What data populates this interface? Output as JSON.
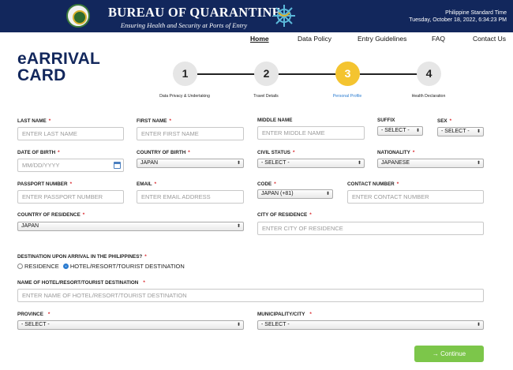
{
  "header": {
    "title": "BUREAU OF QUARANTINE",
    "subtitle": "Ensuring Health and Security at Ports of Entry",
    "time_zone": "Philippine Standard Time",
    "datetime": "Tuesday, October 18, 2022, 6:34:23 PM",
    "bg_color": "#12275c"
  },
  "nav": {
    "items": [
      "Home",
      "Data Policy",
      "Entry Guidelines",
      "FAQ",
      "Contact Us"
    ],
    "active": "Home"
  },
  "page_title": {
    "line1": "eARRIVAL",
    "line2": "CARD"
  },
  "stepper": {
    "steps": [
      {
        "number": "1",
        "label": "Data Privacy & Undertaking"
      },
      {
        "number": "2",
        "label": "Travel Details"
      },
      {
        "number": "3",
        "label": "Personal Profile"
      },
      {
        "number": "4",
        "label": "Health Declaration"
      }
    ],
    "active_step": 3,
    "active_color": "#f4c430"
  },
  "form": {
    "last_name": {
      "label": "LAST NAME",
      "placeholder": "ENTER LAST NAME"
    },
    "first_name": {
      "label": "FIRST NAME",
      "placeholder": "ENTER FIRST NAME"
    },
    "middle_name": {
      "label": "MIDDLE NAME",
      "placeholder": "ENTER MIDDLE NAME"
    },
    "suffix": {
      "label": "SUFFIX",
      "value": "- SELECT -"
    },
    "sex": {
      "label": "SEX",
      "value": "- SELECT -"
    },
    "dob": {
      "label": "DATE OF BIRTH",
      "placeholder": "MM/DD/YYYY"
    },
    "country_of_birth": {
      "label": "COUNTRY OF BIRTH",
      "value": "JAPAN"
    },
    "civil_status": {
      "label": "CIVIL STATUS",
      "value": "- SELECT -"
    },
    "nationality": {
      "label": "NATIONALITY",
      "value": "JAPANESE"
    },
    "passport": {
      "label": "PASSPORT NUMBER",
      "placeholder": "ENTER PASSPORT NUMBER"
    },
    "email": {
      "label": "EMAIL",
      "placeholder": "ENTER EMAIL ADDRESS"
    },
    "code": {
      "label": "CODE",
      "value": "JAPAN (+81)"
    },
    "contact": {
      "label": "CONTACT NUMBER",
      "placeholder": "ENTER CONTACT NUMBER"
    },
    "country_residence": {
      "label": "COUNTRY OF RESIDENCE",
      "value": "JAPAN"
    },
    "city_residence": {
      "label": "CITY OF RESIDENCE",
      "placeholder": "ENTER CITY OF RESIDENCE"
    },
    "destination": {
      "label": "DESTINATION UPON ARRIVAL IN THE PHILIPPINES?",
      "option1": "RESIDENCE",
      "option2": "HOTEL/RESORT/TOURIST DESTINATION",
      "selected": "HOTEL/RESORT/TOURIST DESTINATION"
    },
    "hotel": {
      "label": "NAME OF HOTEL/RESORT/TOURIST DESTINATION",
      "placeholder": "ENTER NAME OF HOTEL/RESORT/TOURIST DESTINATION"
    },
    "province": {
      "label": "PROVINCE",
      "value": "- SELECT -"
    },
    "municipality": {
      "label": "MUNICIPALITY/CITY",
      "value": "- SELECT -"
    }
  },
  "continue_button": {
    "label": "→ Continue",
    "color": "#7cc64a"
  },
  "icons": [
    "seal-icon",
    "ship-wheel-icon",
    "calendar-icon",
    "arrow-right-icon",
    "chevron-updown-icon"
  ]
}
